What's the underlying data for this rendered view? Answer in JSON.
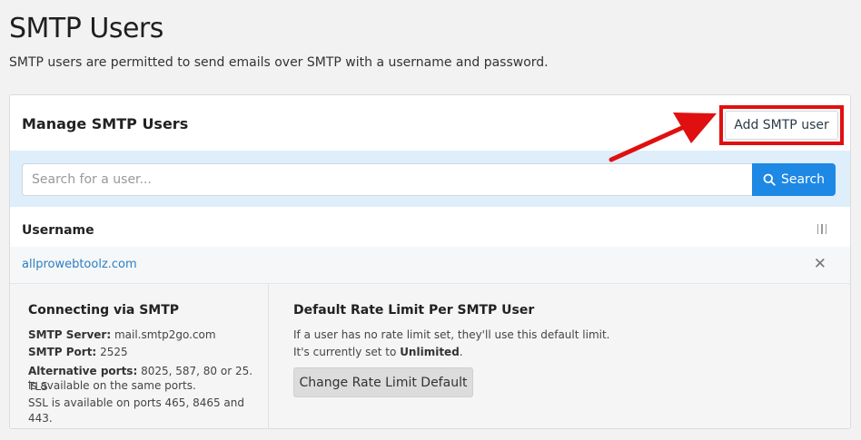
{
  "page": {
    "title": "SMTP Users",
    "subtitle": "SMTP users are permitted to send emails over SMTP with a username and password."
  },
  "card": {
    "title": "Manage SMTP Users",
    "add_button": "Add SMTP user",
    "search": {
      "placeholder": "Search for a user...",
      "button": "Search"
    },
    "table": {
      "header": "Username",
      "rows": [
        {
          "username": "allprowebtoolz.com"
        }
      ]
    },
    "connecting": {
      "heading": "Connecting via SMTP",
      "server_label": "SMTP Server:",
      "server_value": "mail.smtp2go.com",
      "port_label": "SMTP Port:",
      "port_value": "2525",
      "alt_label": "Alternative ports:",
      "alt_value": "8025, 587, 80 or 25. TLS",
      "alt_value2": "is available on the same ports.",
      "ssl_text": "SSL is available on ports 465, 8465 and 443."
    },
    "rate_limit": {
      "heading": "Default Rate Limit Per SMTP User",
      "line1": "If a user has no rate limit set, they'll use this default limit.",
      "line2_prefix": "It's currently set to",
      "line2_value": "Unlimited",
      "line2_suffix": ".",
      "button": "Change Rate Limit Default"
    }
  },
  "colors": {
    "highlight": "#e01010",
    "accent": "#1e88e5",
    "search_band": "#deeefb",
    "link": "#2b7fc4"
  },
  "icons": {
    "search": "search-icon",
    "column_menu": "column-menu-icon",
    "close": "close-icon",
    "annotation_arrow": "arrow-icon"
  }
}
